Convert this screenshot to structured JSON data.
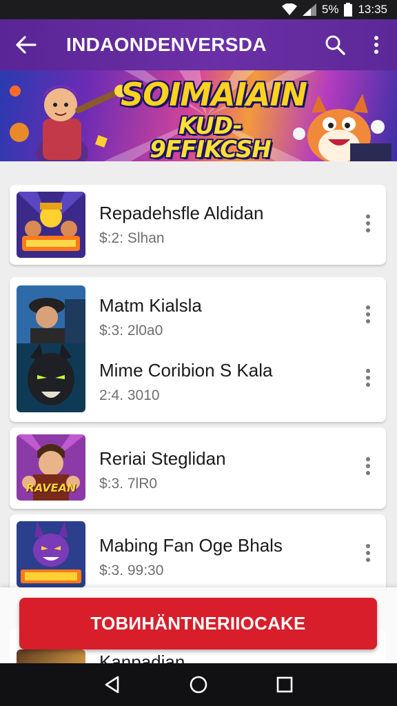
{
  "status_bar": {
    "battery": "5%",
    "time": "13:35"
  },
  "app_bar": {
    "title": "INDAONDENVERSDA"
  },
  "banner": {
    "line1": "SOIMAIAIN",
    "line2": "KUD-9FFIKCSH"
  },
  "items": [
    {
      "name": "Repadehsfle Aldidan",
      "meta": "$:2: Slhan"
    },
    {
      "name": "Matm Kialsla",
      "meta": "$:3: 2l0a0"
    },
    {
      "name": "Mime Coribion S Kala",
      "meta": "2:4. 3010"
    },
    {
      "name": "Reriai Steglidan",
      "meta": "$:3. 7lR0"
    },
    {
      "name": "Mabing Fan Oge Bhals",
      "meta": "$:3. 99:30"
    },
    {
      "name": "Kanpadian"
    }
  ],
  "thumb_texts": {
    "item4": "RAVEAN"
  },
  "cta": {
    "label": "TOBИHÄNTNERIIOCAKE"
  },
  "colors": {
    "app_bar": "#5a2596",
    "cta": "#d71e2a",
    "background": "#eeeeef"
  }
}
